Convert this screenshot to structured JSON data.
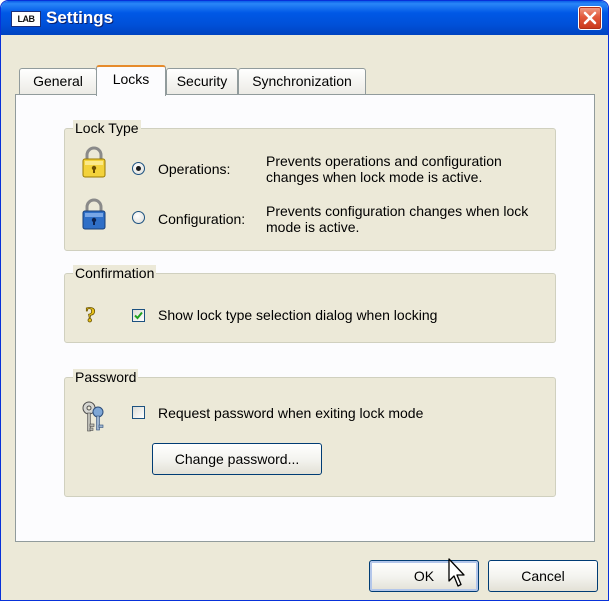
{
  "window": {
    "title": "Settings",
    "app_icon_text": "LAB"
  },
  "tabs": [
    {
      "label": "General",
      "active": false
    },
    {
      "label": "Locks",
      "active": true
    },
    {
      "label": "Security",
      "active": false
    },
    {
      "label": "Synchronization",
      "active": false
    }
  ],
  "lock_type": {
    "group_label": "Lock Type",
    "options": [
      {
        "label": "Operations:",
        "description": "Prevents operations and configuration changes when lock mode is active.",
        "selected": true,
        "icon": "yellow-padlock-icon"
      },
      {
        "label": "Configuration:",
        "description": "Prevents configuration changes when lock mode is active.",
        "selected": false,
        "icon": "blue-padlock-icon"
      }
    ]
  },
  "confirmation": {
    "group_label": "Confirmation",
    "checkbox_label": "Show lock type selection dialog when locking",
    "checked": true,
    "icon": "question-mark-icon"
  },
  "password": {
    "group_label": "Password",
    "checkbox_label": "Request password when exiting lock mode",
    "checked": false,
    "icon": "keys-icon",
    "change_button": "Change password..."
  },
  "footer": {
    "ok_label": "OK",
    "cancel_label": "Cancel"
  },
  "colors": {
    "titlebar": "#0054e3",
    "dialog_bg": "#ece9d8",
    "active_tab_highlight": "#e68b2c",
    "close_button": "#e2593c"
  }
}
